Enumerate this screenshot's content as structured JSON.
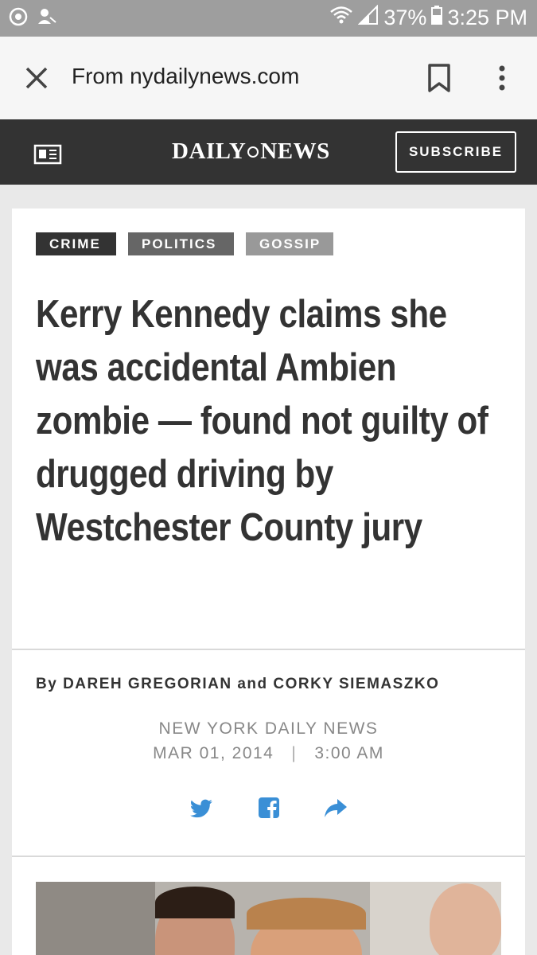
{
  "status_bar": {
    "battery": "37%",
    "time": "3:25 PM",
    "icons": [
      "sync-icon",
      "person-icon",
      "wifi-icon",
      "signal-icon",
      "battery-icon"
    ]
  },
  "toolbar": {
    "title": "From nydailynews.com",
    "icons": [
      "close-icon",
      "bookmark-icon",
      "more-vert-icon"
    ]
  },
  "site_header": {
    "logo_left": "DAILY",
    "logo_right": "NEWS",
    "subscribe_label": "SUBSCRIBE",
    "background": "#333333"
  },
  "article": {
    "tags": [
      {
        "label": "CRIME",
        "color": "#333333"
      },
      {
        "label": "POLITICS",
        "color": "#666666"
      },
      {
        "label": "GOSSIP",
        "color": "#999999"
      }
    ],
    "headline": "Kerry Kennedy claims she was accidental Ambien zombie — found not guilty of drugged driving by Westchester County jury",
    "byline": "By DAREH GREGORIAN and CORKY SIEMASZKO",
    "source": "NEW YORK DAILY NEWS",
    "date": "MAR 01, 2014",
    "separator": "|",
    "time": "3:00 AM",
    "share_icons": [
      "twitter-icon",
      "facebook-icon",
      "share-icon"
    ],
    "share_color": "#3a8fd6"
  }
}
